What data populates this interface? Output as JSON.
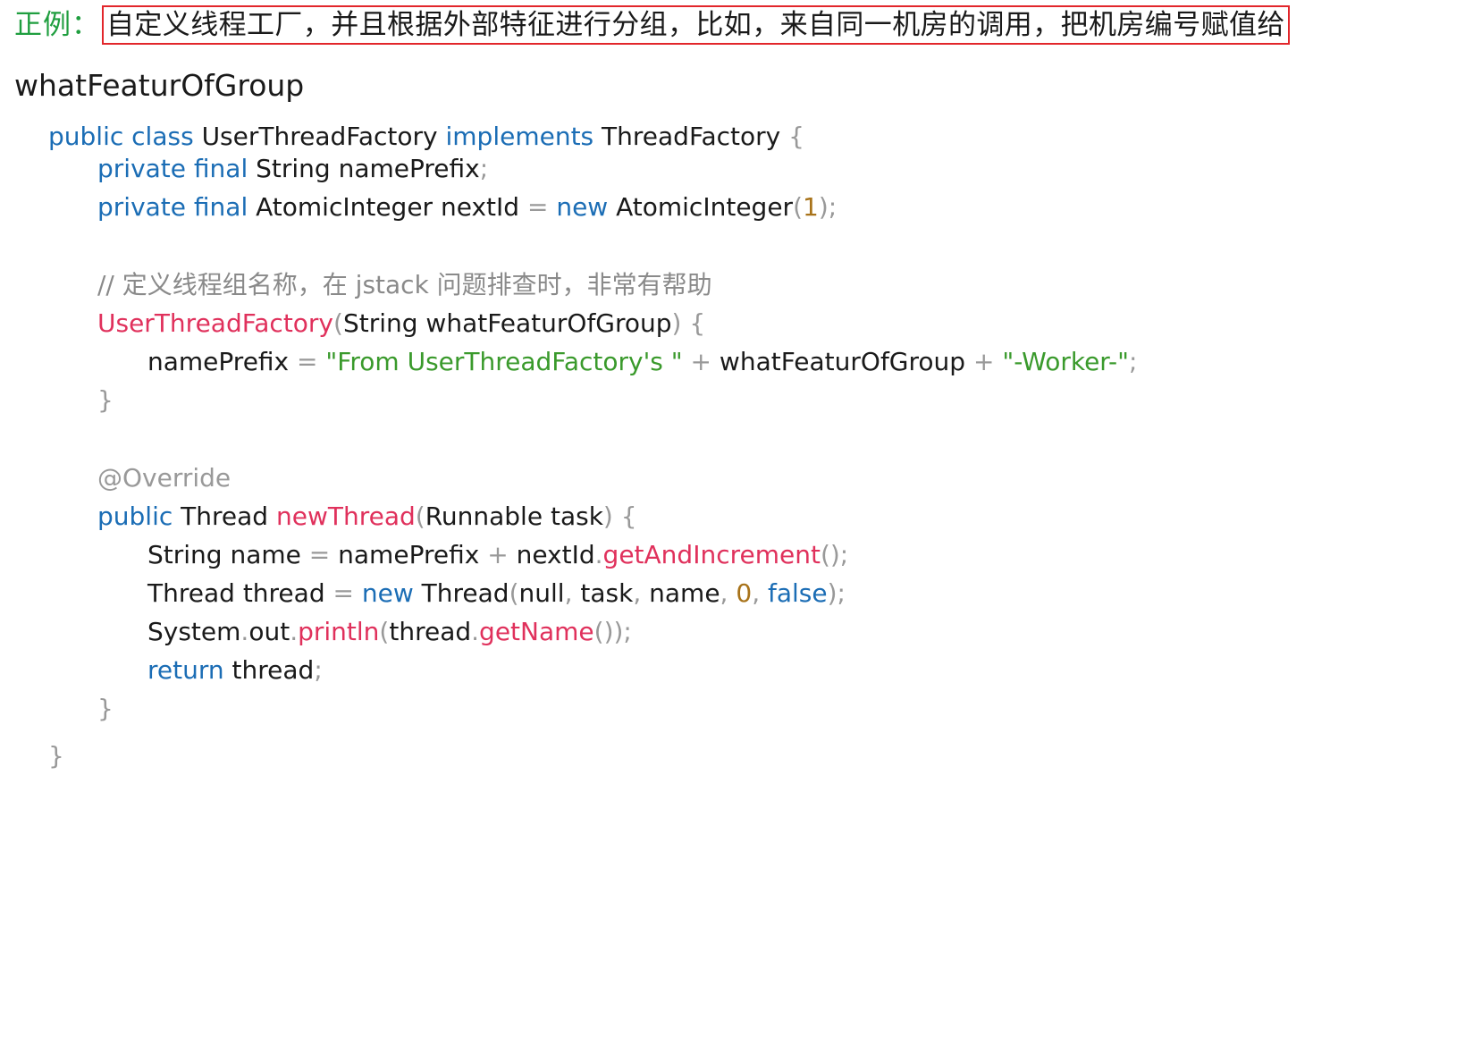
{
  "heading": {
    "label": "正例：",
    "text": "自定义线程工厂，并且根据外部特征进行分组，比如，来自同一机房的调用，把机房编号赋值给"
  },
  "subheading": "whatFeaturOfGroup",
  "colors": {
    "keyword": "#1b6db5",
    "function": "#e0315c",
    "string": "#3a9a2c",
    "number": "#a8731a",
    "comment": "#8a8a8a",
    "punctuation": "#999999",
    "highlight_box": "#e2262b",
    "label": "#1f9e3f"
  },
  "code": {
    "l1": {
      "kw1": "public class",
      "id1": "UserThreadFactory",
      "kw2": "implements",
      "id2": "ThreadFactory",
      "p1": "{"
    },
    "l2": {
      "kw": "private final",
      "id1": "String",
      "id2": "namePrefix",
      "p1": ";"
    },
    "l3": {
      "kw1": "private final",
      "id1": "AtomicInteger",
      "id2": "nextId",
      "op": "=",
      "kw2": "new",
      "id3": "AtomicInteger",
      "p1": "(",
      "num": "1",
      "p2": ");"
    },
    "l4": {
      "comment": "// 定义线程组名称，在 jstack 问题排查时，非常有帮助"
    },
    "l5": {
      "fn": "UserThreadFactory",
      "p1": "(",
      "id1": "String",
      "id2": "whatFeaturOfGroup",
      "p2": ") {"
    },
    "l6": {
      "id1": "namePrefix",
      "op1": "=",
      "s1": "\"From UserThreadFactory's \"",
      "op2": "+",
      "id2": "whatFeaturOfGroup",
      "op3": "+",
      "s2": "\"-Worker-\"",
      "p1": ";"
    },
    "l7": {
      "p1": "}"
    },
    "l8": {
      "annotation": "@Override"
    },
    "l9": {
      "kw": "public",
      "id1": "Thread",
      "fn": "newThread",
      "p1": "(",
      "id2": "Runnable",
      "id3": "task",
      "p2": ") {"
    },
    "l10": {
      "id1": "String",
      "id2": "name",
      "op1": "=",
      "id3": "namePrefix",
      "op2": "+",
      "id4": "nextId",
      "p1": ".",
      "fn": "getAndIncrement",
      "p2": "();"
    },
    "l11": {
      "id1": "Thread",
      "id2": "thread",
      "op": "=",
      "kw1": "new",
      "id3": "Thread",
      "p1": "(",
      "id4": "null",
      "p2": ",",
      "id5": "task",
      "p3": ",",
      "id6": "name",
      "p4": ",",
      "num": "0",
      "p5": ",",
      "kw2": "false",
      "p6": ");"
    },
    "l12": {
      "id1": "System",
      "p1": ".",
      "id2": "out",
      "p2": ".",
      "fn1": "println",
      "p3": "(",
      "id3": "thread",
      "p4": ".",
      "fn2": "getName",
      "p5": "());"
    },
    "l13": {
      "kw": "return",
      "id": "thread",
      "p1": ";"
    },
    "l14": {
      "p1": "}"
    },
    "l15": {
      "p1": "}"
    }
  }
}
